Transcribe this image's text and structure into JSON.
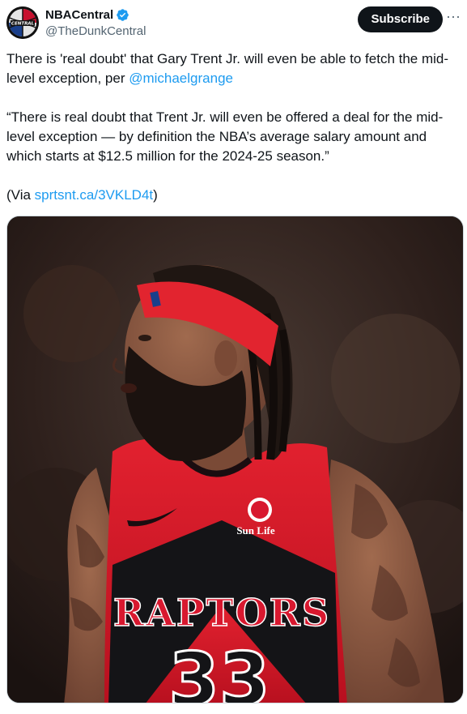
{
  "author": {
    "display_name": "NBACentral",
    "handle": "@TheDunkCentral",
    "verified": true,
    "avatar_text": "CENTRAL",
    "avatar_icon": "basketball-logo-icon"
  },
  "actions": {
    "subscribe_label": "Subscribe",
    "more_label": "···"
  },
  "tweet": {
    "line1_text": "There is 'real doubt' that Gary Trent Jr. will even be able to fetch the mid-level exception, per ",
    "line1_mention": "@michaelgrange",
    "quote": "“There is real doubt that Trent Jr. will even be offered a deal for the mid-level exception — by definition the NBA’s average salary amount and which starts at $12.5 million for the 2024-25 season.”",
    "via_prefix": "(Via ",
    "via_link": "sprtsnt.ca/3VKLD4t",
    "via_suffix": ")"
  },
  "media": {
    "jersey_text": "RAPTORS",
    "jersey_number": "33",
    "sponsor_text": "Sun Life"
  },
  "colors": {
    "link": "#1d9bf0",
    "verified": "#1d9bf0",
    "subscribe_bg": "#0f1419",
    "jersey_red": "#d8182f",
    "headband_red": "#e2242f"
  }
}
